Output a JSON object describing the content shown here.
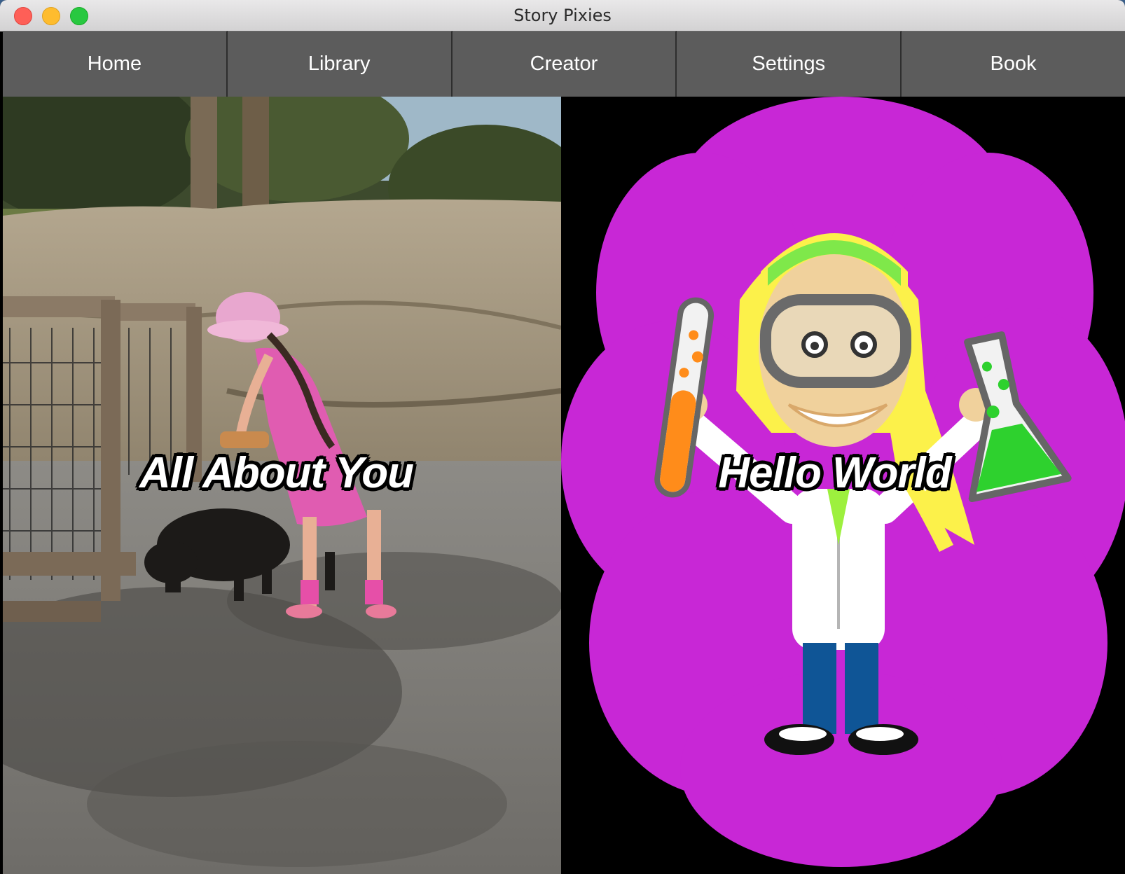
{
  "window": {
    "title": "Story Pixies"
  },
  "nav": {
    "items": [
      {
        "label": "Home"
      },
      {
        "label": "Library"
      },
      {
        "label": "Creator"
      },
      {
        "label": "Settings"
      },
      {
        "label": "Book"
      }
    ]
  },
  "books": [
    {
      "title": "All About You",
      "cover": "photo-girl-with-goat"
    },
    {
      "title": "Hello World",
      "cover": "scientist-girl-cartoon",
      "cover_bg": "#c827d6"
    }
  ],
  "colors": {
    "nav_bg": "#5c5c5c",
    "nav_text": "#ffffff",
    "cloud": "#c827d6"
  }
}
